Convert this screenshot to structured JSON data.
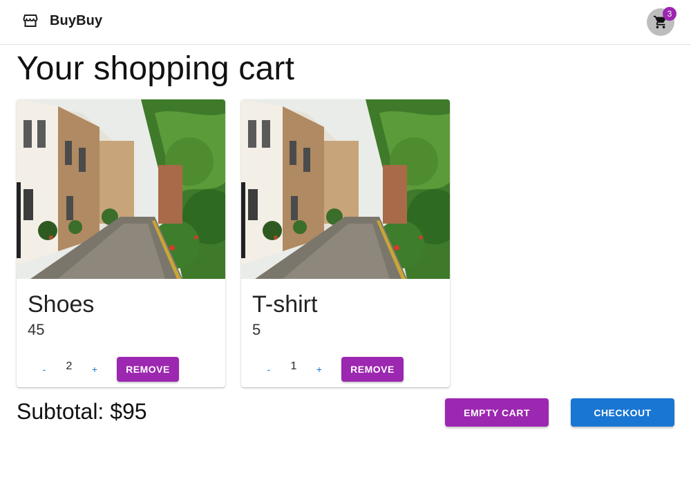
{
  "header": {
    "brand_name": "BuyBuy",
    "brand_icon": "storefront-icon",
    "cart_icon": "shopping-cart-icon",
    "cart_badge_count": "3"
  },
  "page": {
    "title": "Your shopping cart"
  },
  "cart": {
    "items": [
      {
        "name": "Shoes",
        "price": "45",
        "quantity": "2",
        "decrement_label": "-",
        "increment_label": "+",
        "remove_label": "REMOVE",
        "image": "street-photo"
      },
      {
        "name": "T-shirt",
        "price": "5",
        "quantity": "1",
        "decrement_label": "-",
        "increment_label": "+",
        "remove_label": "REMOVE",
        "image": "street-photo"
      }
    ],
    "subtotal_text": "Subtotal: $95",
    "empty_cart_label": "EMPTY CART",
    "checkout_label": "CHECKOUT"
  },
  "colors": {
    "primary_purple": "#9c27b0",
    "primary_blue": "#1976d2"
  }
}
